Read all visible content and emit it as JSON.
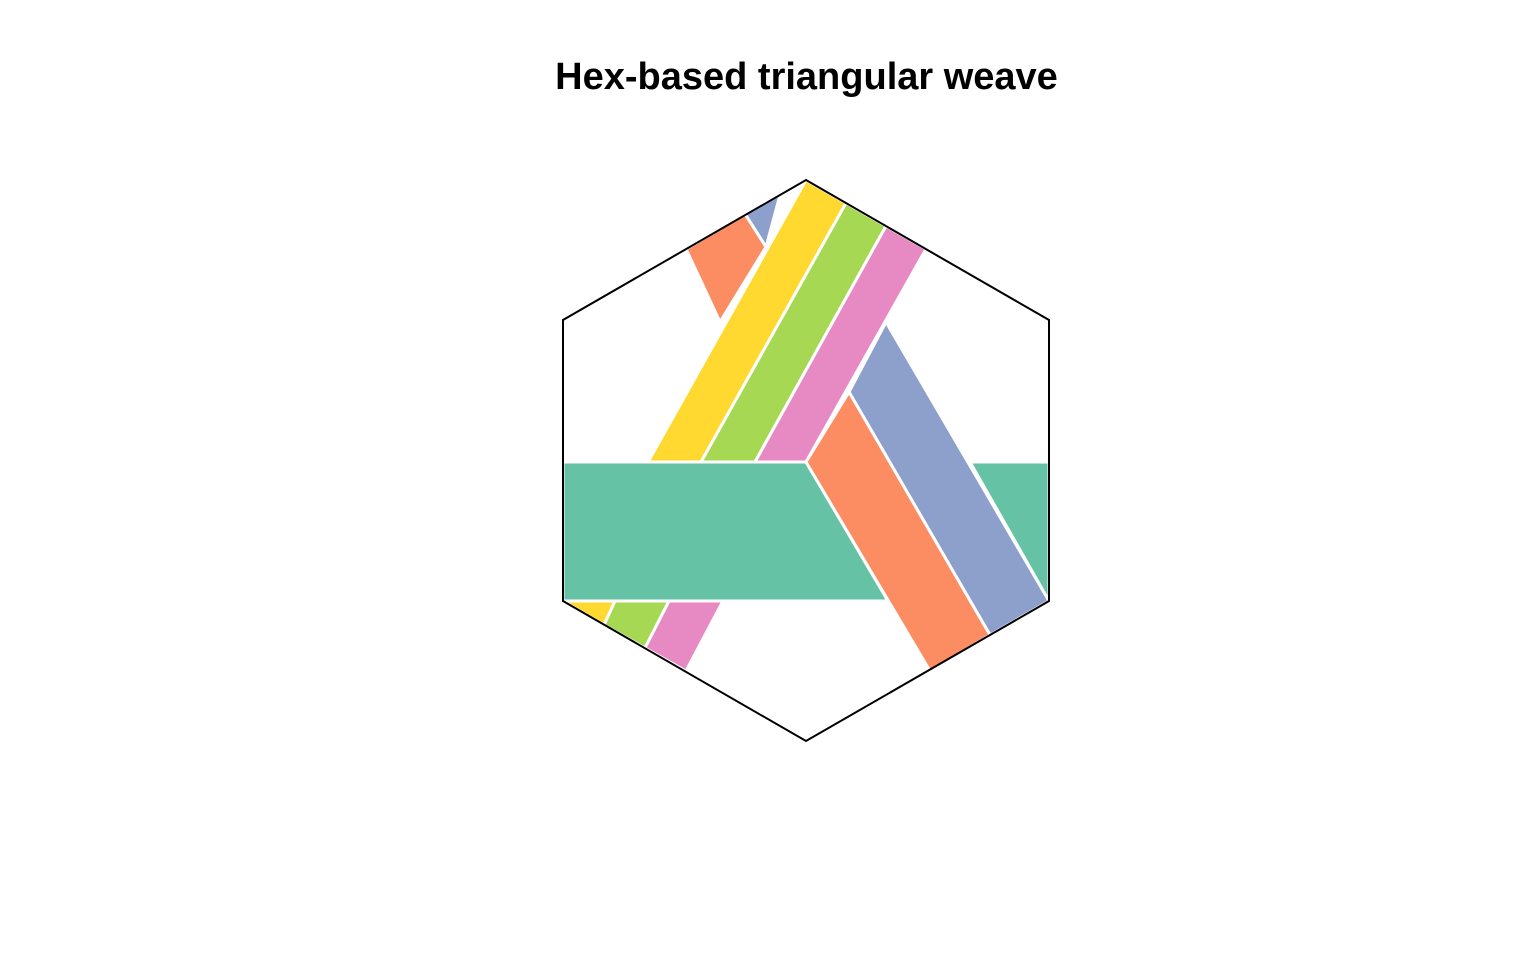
{
  "title": "Hex-based triangular weave",
  "palette": {
    "teal": "#66c2a5",
    "orange": "#fc8d62",
    "blue": "#8da0cb",
    "pink": "#e78ac3",
    "green": "#a6d854",
    "yellow": "#ffd92f",
    "gap_stroke": "#ffffff",
    "outline": "#000000",
    "background": "#ffffff"
  },
  "strand_groups": [
    {
      "name": "horizontal",
      "colors": [
        "teal"
      ]
    },
    {
      "name": "down-right diagonal",
      "colors": [
        "orange",
        "blue"
      ]
    },
    {
      "name": "up-right diagonal",
      "colors": [
        "yellow",
        "green",
        "pink"
      ]
    }
  ]
}
